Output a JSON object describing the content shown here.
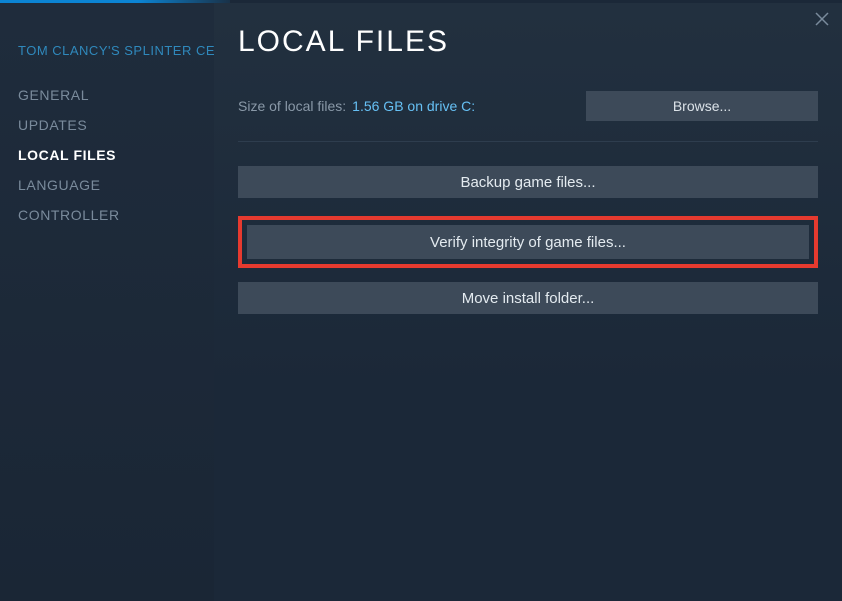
{
  "sidebar": {
    "game_title": "TOM CLANCY'S SPLINTER CELL",
    "items": [
      {
        "label": "GENERAL"
      },
      {
        "label": "UPDATES"
      },
      {
        "label": "LOCAL FILES"
      },
      {
        "label": "LANGUAGE"
      },
      {
        "label": "CONTROLLER"
      }
    ],
    "active_index": 2
  },
  "main": {
    "title": "LOCAL FILES",
    "size_label": "Size of local files:",
    "size_value": "1.56 GB on drive C:",
    "browse_label": "Browse...",
    "backup_label": "Backup game files...",
    "verify_label": "Verify integrity of game files...",
    "move_label": "Move install folder..."
  }
}
